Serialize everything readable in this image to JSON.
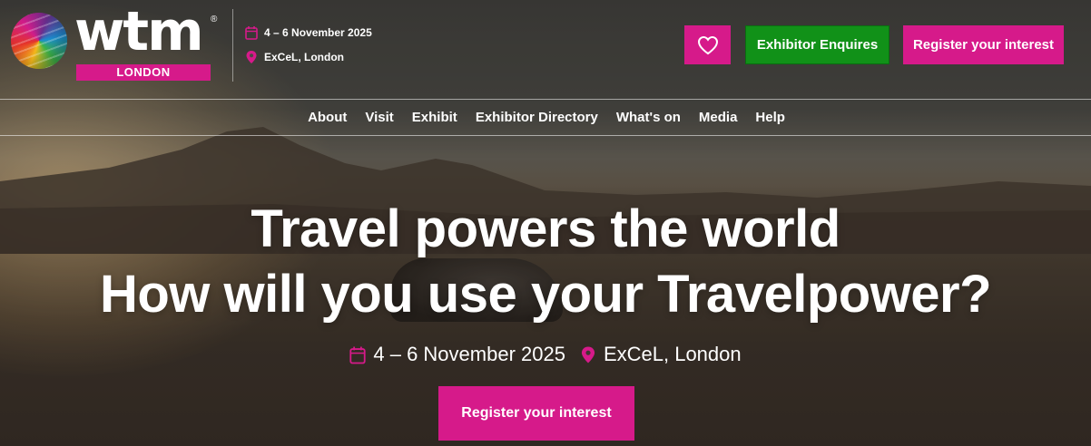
{
  "brand": {
    "wordmark": "wtm",
    "registered": "®",
    "city": "LONDON"
  },
  "event": {
    "dates": "4 – 6 November 2025",
    "venue": "ExCeL, London"
  },
  "header_buttons": {
    "favourite_icon": "heart-icon",
    "exhibitor": "Exhibitor Enquires",
    "register": "Register your interest"
  },
  "nav": {
    "items": [
      "About",
      "Visit",
      "Exhibit",
      "Exhibitor Directory",
      "What's on",
      "Media",
      "Help"
    ]
  },
  "hero": {
    "line1": "Travel powers the world",
    "line2": "How will you use your Travelpower?",
    "dates": "4 – 6 November 2025",
    "venue": "ExCeL, London",
    "cta": "Register your interest"
  },
  "colors": {
    "accent_pink": "#d61a8a",
    "exhibitor_green": "#119118"
  }
}
